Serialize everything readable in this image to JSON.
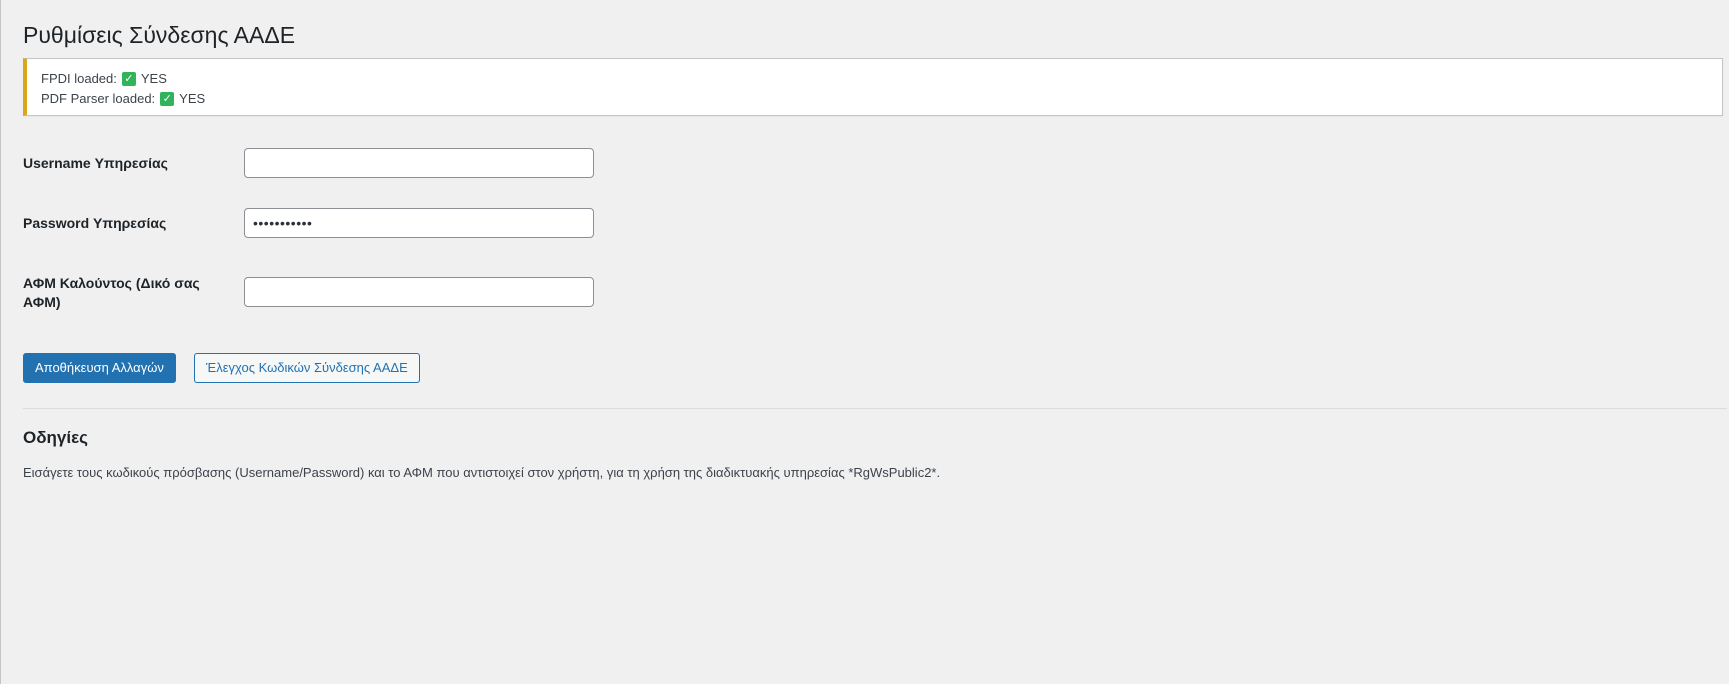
{
  "page": {
    "title": "Ρυθμίσεις Σύνδεσης ΑΑΔΕ"
  },
  "notice": {
    "lines": [
      {
        "label": "FPDI loaded:",
        "status": "YES",
        "icon": "check-mark-icon"
      },
      {
        "label": "PDF Parser loaded:",
        "status": "YES",
        "icon": "check-mark-icon"
      }
    ],
    "border_color": "#dba617",
    "check_color": "#2fb45a"
  },
  "form": {
    "username": {
      "label": "Username Υπηρεσίας",
      "value": ""
    },
    "password": {
      "label": "Password Υπηρεσίας",
      "value": "•••••••••••"
    },
    "afm": {
      "label": "ΑΦΜ Καλούντος (Δικό σας ΑΦΜ)",
      "value": ""
    }
  },
  "actions": {
    "save_label": "Αποθήκευση Αλλαγών",
    "check_label": "Έλεγχος Κωδικών Σύνδεσης ΑΑΔΕ",
    "primary_color": "#2271b1"
  },
  "instructions": {
    "heading": "Οδηγίες",
    "text": "Εισάγετε τους κωδικούς πρόσβασης (Username/Password) και το ΑΦΜ που αντιστοιχεί στον χρήστη, για τη χρήση της διαδικτυακής υπηρεσίας *RgWsPublic2*."
  }
}
